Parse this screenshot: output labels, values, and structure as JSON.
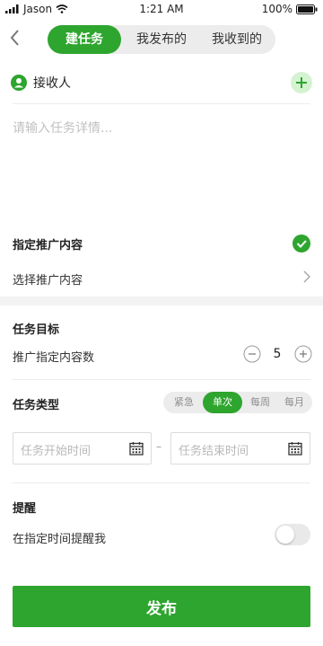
{
  "status_bar": {
    "carrier": "Jason",
    "time": "1:21 AM",
    "battery": "100%"
  },
  "header": {
    "tabs": [
      {
        "label": "建任务",
        "active": true
      },
      {
        "label": "我发布的",
        "active": false
      },
      {
        "label": "我收到的",
        "active": false
      }
    ]
  },
  "receiver": {
    "label": "接收人"
  },
  "task": {
    "placeholder": "请输入任务详情..."
  },
  "promo": {
    "title": "指定推广内容",
    "select_label": "选择推广内容"
  },
  "goal": {
    "title": "任务目标",
    "label": "推广指定内容数",
    "value": "5"
  },
  "task_type": {
    "title": "任务类型",
    "options": [
      {
        "label": "紧急",
        "active": false
      },
      {
        "label": "单次",
        "active": true
      },
      {
        "label": "每周",
        "active": false
      },
      {
        "label": "每月",
        "active": false
      }
    ]
  },
  "dates": {
    "start_placeholder": "任务开始时间",
    "end_placeholder": "任务结束时间",
    "separator": "–"
  },
  "reminder": {
    "title": "提醒",
    "label": "在指定时间提醒我",
    "enabled": false
  },
  "publish_label": "发布",
  "colors": {
    "accent": "#2ea52e",
    "accent_light": "#d4f3d1"
  }
}
